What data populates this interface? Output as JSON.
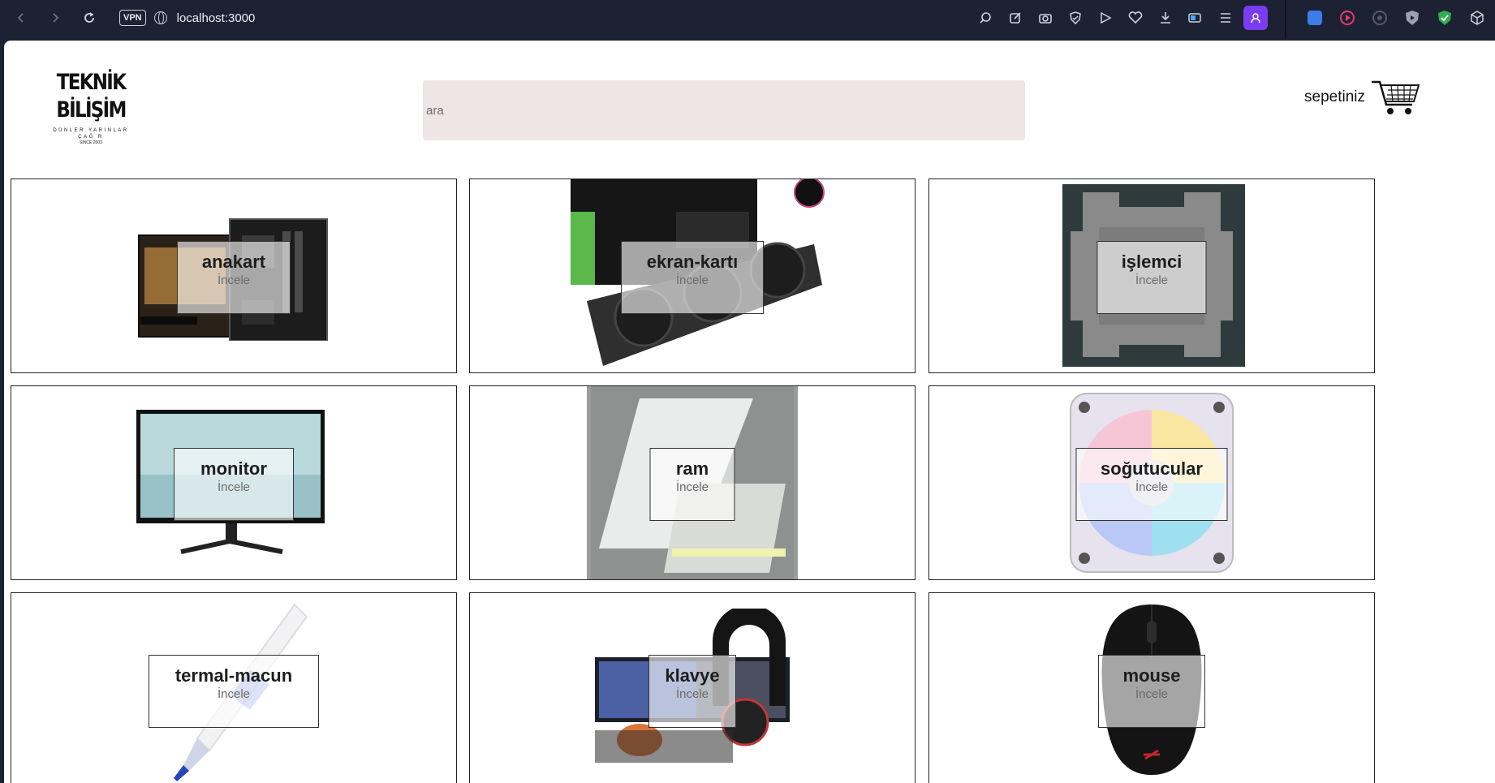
{
  "browser": {
    "url": "localhost:3000",
    "vpn_label": "VPN"
  },
  "header": {
    "logo_line1": "TEKNİK",
    "logo_line2": "BİLİŞİM",
    "logo_tagline": "DÜNLER YARINLAR ÇAĞ R",
    "logo_since": "SİNCE 2003",
    "search_placeholder": "ara",
    "cart_label": "sepetiniz"
  },
  "categories": [
    {
      "title": "anakart",
      "action": "İncele"
    },
    {
      "title": "ekran-kartı",
      "action": "İncele"
    },
    {
      "title": "işlemci",
      "action": "İncele"
    },
    {
      "title": "monitor",
      "action": "İncele"
    },
    {
      "title": "ram",
      "action": "İncele"
    },
    {
      "title": "soğutucular",
      "action": "İncele"
    },
    {
      "title": "termal-macun",
      "action": "İncele"
    },
    {
      "title": "klavye",
      "action": "İncele"
    },
    {
      "title": "mouse",
      "action": "İncele"
    }
  ]
}
